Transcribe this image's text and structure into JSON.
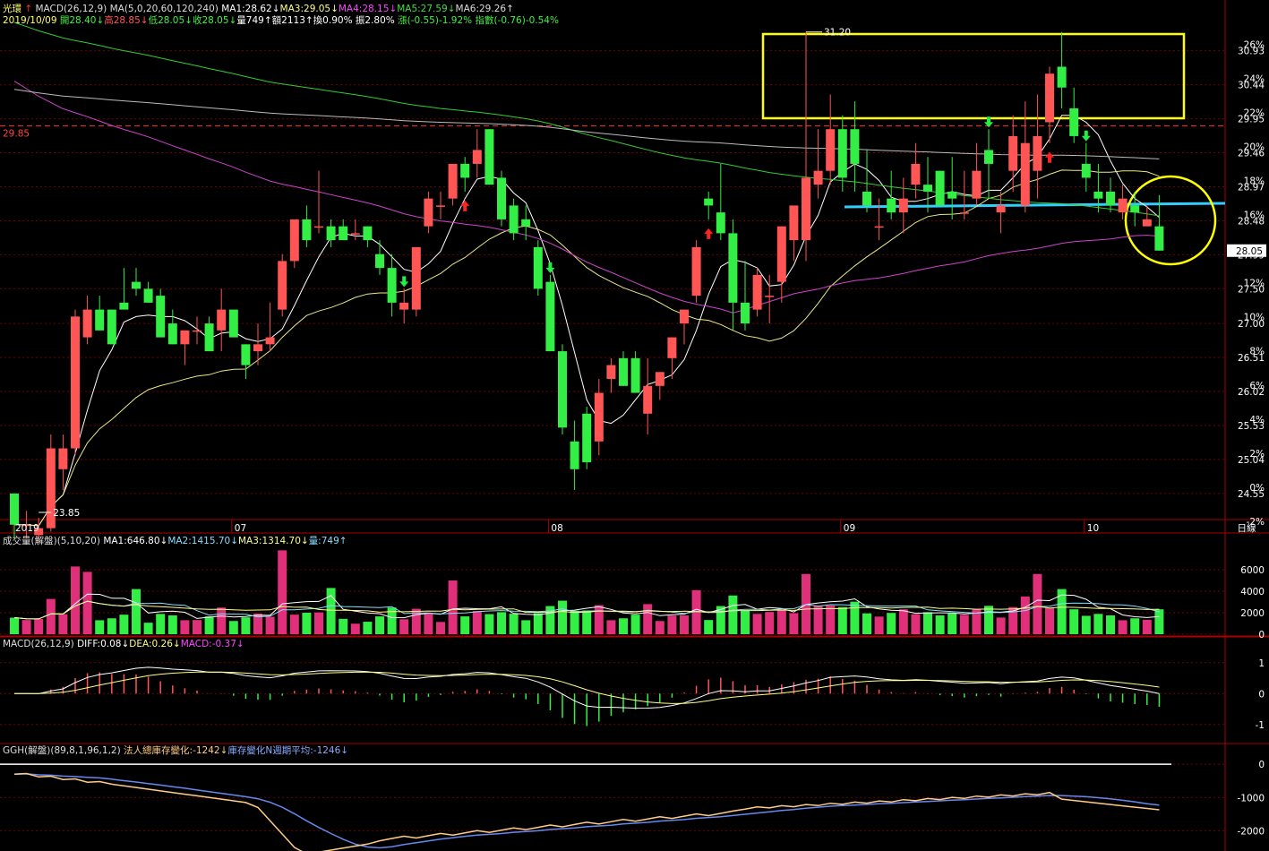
{
  "header": {
    "stock_name": "光環",
    "macd_label": "MACD(26,12,9)",
    "ma_label": "MA(5,0,20,60,120,240)",
    "ma1": "MA1:28.62↓",
    "ma3": "MA3:29.05↓",
    "ma4": "MA4:28.15↓",
    "ma5": "MA5:27.59↓",
    "ma6": "MA6:29.26↑",
    "date": "2019/10/09",
    "open": "開28.40↓",
    "high": "高28.85↓",
    "low": "低28.05↓",
    "close": "收28.05↓",
    "vol": "量749↑",
    "amount": "額2113↑",
    "turnover": "換0.90%",
    "amplitude": "振2.80%",
    "change": "漲(-0.55)-1.92%",
    "index": "指數(-0.76)-0.54%"
  },
  "volume_header": {
    "title": "成交量(解盤)(5,10,20)",
    "ma1": "MA1:646.80↓",
    "ma2": "MA2:1415.70↓",
    "ma3": "MA3:1314.70↓",
    "vol": "量:749↑"
  },
  "macd_header": {
    "title": "MACD(26,12,9)",
    "diff": "DIFF:0.08↓",
    "dea": "DEA:0.26↓",
    "macd": "MACD:-0.37↓"
  },
  "ggh_header": {
    "title": "GGH(解盤)(89,8,1,96,1,2)",
    "inst": "法人總庫存變化:-1242↓",
    "avg": "庫存變化N週期平均:-1246↓"
  },
  "colors": {
    "up": "#ff5555",
    "down": "#33ee44",
    "grid": "#700000",
    "axis_text": "#ffffff",
    "highlight_box": "#ffff00",
    "support_line": "#33ccff",
    "ma_white": "#ffffff",
    "ma_yellow": "#e8e888",
    "ma_green": "#33cc33",
    "ma_purple": "#cc44cc",
    "ma_gray": "#bbbbbb"
  },
  "chart_data": [
    {
      "type": "candlestick",
      "title": "光環",
      "date_labels": [
        "2019",
        "07",
        "08",
        "09",
        "10"
      ],
      "period": "日線",
      "price_ticks": [
        "30.93",
        "30.44",
        "29.95",
        "29.46",
        "28.97",
        "28.48",
        "27.99",
        "27.50",
        "27.00",
        "26.51",
        "26.02",
        "25.53",
        "25.04",
        "24.55"
      ],
      "pct_ticks": [
        "26%",
        "24%",
        "22%",
        "20%",
        "18%",
        "16%",
        "14%",
        "12%",
        "10%",
        "8%",
        "6%",
        "4%",
        "2%",
        "0%",
        "-2%"
      ],
      "current_price_label": "28.05",
      "reference_price_label": "29.85",
      "annotation_high": "31.20",
      "annotation_low": "23.85",
      "ylim": [
        24.2,
        31.3
      ],
      "ohlc": [
        [
          24.55,
          24.55,
          23.9,
          24.1
        ],
        [
          24.1,
          24.3,
          23.9,
          24.1
        ],
        [
          23.95,
          24.2,
          23.85,
          24.05
        ],
        [
          24.05,
          25.4,
          24.0,
          25.2
        ],
        [
          24.9,
          25.4,
          24.6,
          25.2
        ],
        [
          25.2,
          27.2,
          25.1,
          27.1
        ],
        [
          26.8,
          27.4,
          26.7,
          27.2
        ],
        [
          27.2,
          27.4,
          26.9,
          26.9
        ],
        [
          27.2,
          27.2,
          26.7,
          26.7
        ],
        [
          27.3,
          27.8,
          27.2,
          27.2
        ],
        [
          27.6,
          27.8,
          27.4,
          27.5
        ],
        [
          27.5,
          27.6,
          27.3,
          27.3
        ],
        [
          27.4,
          27.5,
          26.8,
          26.8
        ],
        [
          27.0,
          27.2,
          26.7,
          26.7
        ],
        [
          26.7,
          26.9,
          26.4,
          26.9
        ],
        [
          26.9,
          27.1,
          26.7,
          26.9
        ],
        [
          27.0,
          27.1,
          26.6,
          26.6
        ],
        [
          26.9,
          27.5,
          26.6,
          27.2
        ],
        [
          27.2,
          27.2,
          26.8,
          26.8
        ],
        [
          26.7,
          26.7,
          26.2,
          26.4
        ],
        [
          26.6,
          27.0,
          26.4,
          26.7
        ],
        [
          26.7,
          27.3,
          26.6,
          26.8
        ],
        [
          27.2,
          28.0,
          27.1,
          27.9
        ],
        [
          27.9,
          28.4,
          27.8,
          28.5
        ],
        [
          28.5,
          28.7,
          28.1,
          28.2
        ],
        [
          28.4,
          29.2,
          28.3,
          28.4
        ],
        [
          28.4,
          28.5,
          28.1,
          28.2
        ],
        [
          28.4,
          28.5,
          28.2,
          28.2
        ],
        [
          28.3,
          28.5,
          28.2,
          28.3
        ],
        [
          28.4,
          28.4,
          28.1,
          28.2
        ],
        [
          28.0,
          28.2,
          27.7,
          27.8
        ],
        [
          27.8,
          28.0,
          27.1,
          27.3
        ],
        [
          27.2,
          27.5,
          27.0,
          27.3
        ],
        [
          27.2,
          28.1,
          27.1,
          28.1
        ],
        [
          28.4,
          28.9,
          28.3,
          28.8
        ],
        [
          28.7,
          28.9,
          28.5,
          28.7
        ],
        [
          28.8,
          29.3,
          28.7,
          29.3
        ],
        [
          29.3,
          29.4,
          28.9,
          29.1
        ],
        [
          29.3,
          29.8,
          29.1,
          29.5
        ],
        [
          29.8,
          29.8,
          29.0,
          29.0
        ],
        [
          29.1,
          29.2,
          28.4,
          28.5
        ],
        [
          28.7,
          28.8,
          28.2,
          28.3
        ],
        [
          28.5,
          28.7,
          28.2,
          28.4
        ],
        [
          28.1,
          28.2,
          27.4,
          27.5
        ],
        [
          27.6,
          27.7,
          26.6,
          26.6
        ],
        [
          26.6,
          26.7,
          25.4,
          25.5
        ],
        [
          25.3,
          25.6,
          24.6,
          24.9
        ],
        [
          25.7,
          25.8,
          24.9,
          25.0
        ],
        [
          25.3,
          26.2,
          25.1,
          26.0
        ],
        [
          26.2,
          26.5,
          26.0,
          26.4
        ],
        [
          26.5,
          26.6,
          26.1,
          26.1
        ],
        [
          26.5,
          26.6,
          26.0,
          26.0
        ],
        [
          25.7,
          26.5,
          25.4,
          26.1
        ],
        [
          26.1,
          26.3,
          25.9,
          26.3
        ],
        [
          26.5,
          26.8,
          26.2,
          26.8
        ],
        [
          27.0,
          27.2,
          26.7,
          27.2
        ],
        [
          27.4,
          28.2,
          27.3,
          28.1
        ],
        [
          28.8,
          28.9,
          28.5,
          28.7
        ],
        [
          28.6,
          29.3,
          28.2,
          28.3
        ],
        [
          28.3,
          28.5,
          26.9,
          27.3
        ],
        [
          27.3,
          27.9,
          26.9,
          27.0
        ],
        [
          27.2,
          27.8,
          27.1,
          27.7
        ],
        [
          27.4,
          27.7,
          27.0,
          27.4
        ],
        [
          27.6,
          28.4,
          27.3,
          28.4
        ],
        [
          28.2,
          28.7,
          27.9,
          28.7
        ],
        [
          28.2,
          31.2,
          27.9,
          29.1
        ],
        [
          29.0,
          29.8,
          28.8,
          29.2
        ],
        [
          29.2,
          30.3,
          29.0,
          29.8
        ],
        [
          29.8,
          30.0,
          28.9,
          29.1
        ],
        [
          29.8,
          30.2,
          28.9,
          29.3
        ],
        [
          28.9,
          29.5,
          28.6,
          28.7
        ],
        [
          28.4,
          28.8,
          28.2,
          28.4
        ],
        [
          28.8,
          29.2,
          28.5,
          28.6
        ],
        [
          28.6,
          29.1,
          28.3,
          28.8
        ],
        [
          29.0,
          29.6,
          28.8,
          29.3
        ],
        [
          29.0,
          29.4,
          28.6,
          28.9
        ],
        [
          29.2,
          29.2,
          28.7,
          28.7
        ],
        [
          28.9,
          29.4,
          28.5,
          28.8
        ],
        [
          28.6,
          29.2,
          28.5,
          28.6
        ],
        [
          28.8,
          29.6,
          28.7,
          29.2
        ],
        [
          29.5,
          29.8,
          28.8,
          29.3
        ],
        [
          28.6,
          28.9,
          28.3,
          28.7
        ],
        [
          29.2,
          30.0,
          28.9,
          29.7
        ],
        [
          28.7,
          30.2,
          28.6,
          29.6
        ],
        [
          29.2,
          30.3,
          28.8,
          29.7
        ],
        [
          29.9,
          30.7,
          29.6,
          30.6
        ],
        [
          30.7,
          31.2,
          30.1,
          30.4
        ],
        [
          30.1,
          30.4,
          29.6,
          29.7
        ],
        [
          29.3,
          29.6,
          28.9,
          29.1
        ],
        [
          28.9,
          29.3,
          28.6,
          28.8
        ],
        [
          28.9,
          29.1,
          28.6,
          28.7
        ],
        [
          28.6,
          29.0,
          28.5,
          28.8
        ],
        [
          28.7,
          28.9,
          28.4,
          28.6
        ],
        [
          28.4,
          28.7,
          28.4,
          28.5
        ],
        [
          28.4,
          28.85,
          28.05,
          28.05
        ]
      ]
    },
    {
      "type": "bar",
      "title": "成交量(解盤)(5,10,20)",
      "yticks": [
        "6000",
        "4000",
        "2000",
        "0"
      ],
      "ylim": [
        0,
        8000
      ]
    },
    {
      "type": "bar",
      "title": "MACD(26,12,9)",
      "yticks": [
        "1",
        "0",
        "-1"
      ],
      "ylim": [
        -1.5,
        1.4
      ]
    },
    {
      "type": "line",
      "title": "GGH(解盤)(89,8,1,96,1,2)",
      "yticks": [
        "0",
        "-1000",
        "-2000"
      ],
      "ylim": [
        -2500,
        300
      ]
    }
  ]
}
